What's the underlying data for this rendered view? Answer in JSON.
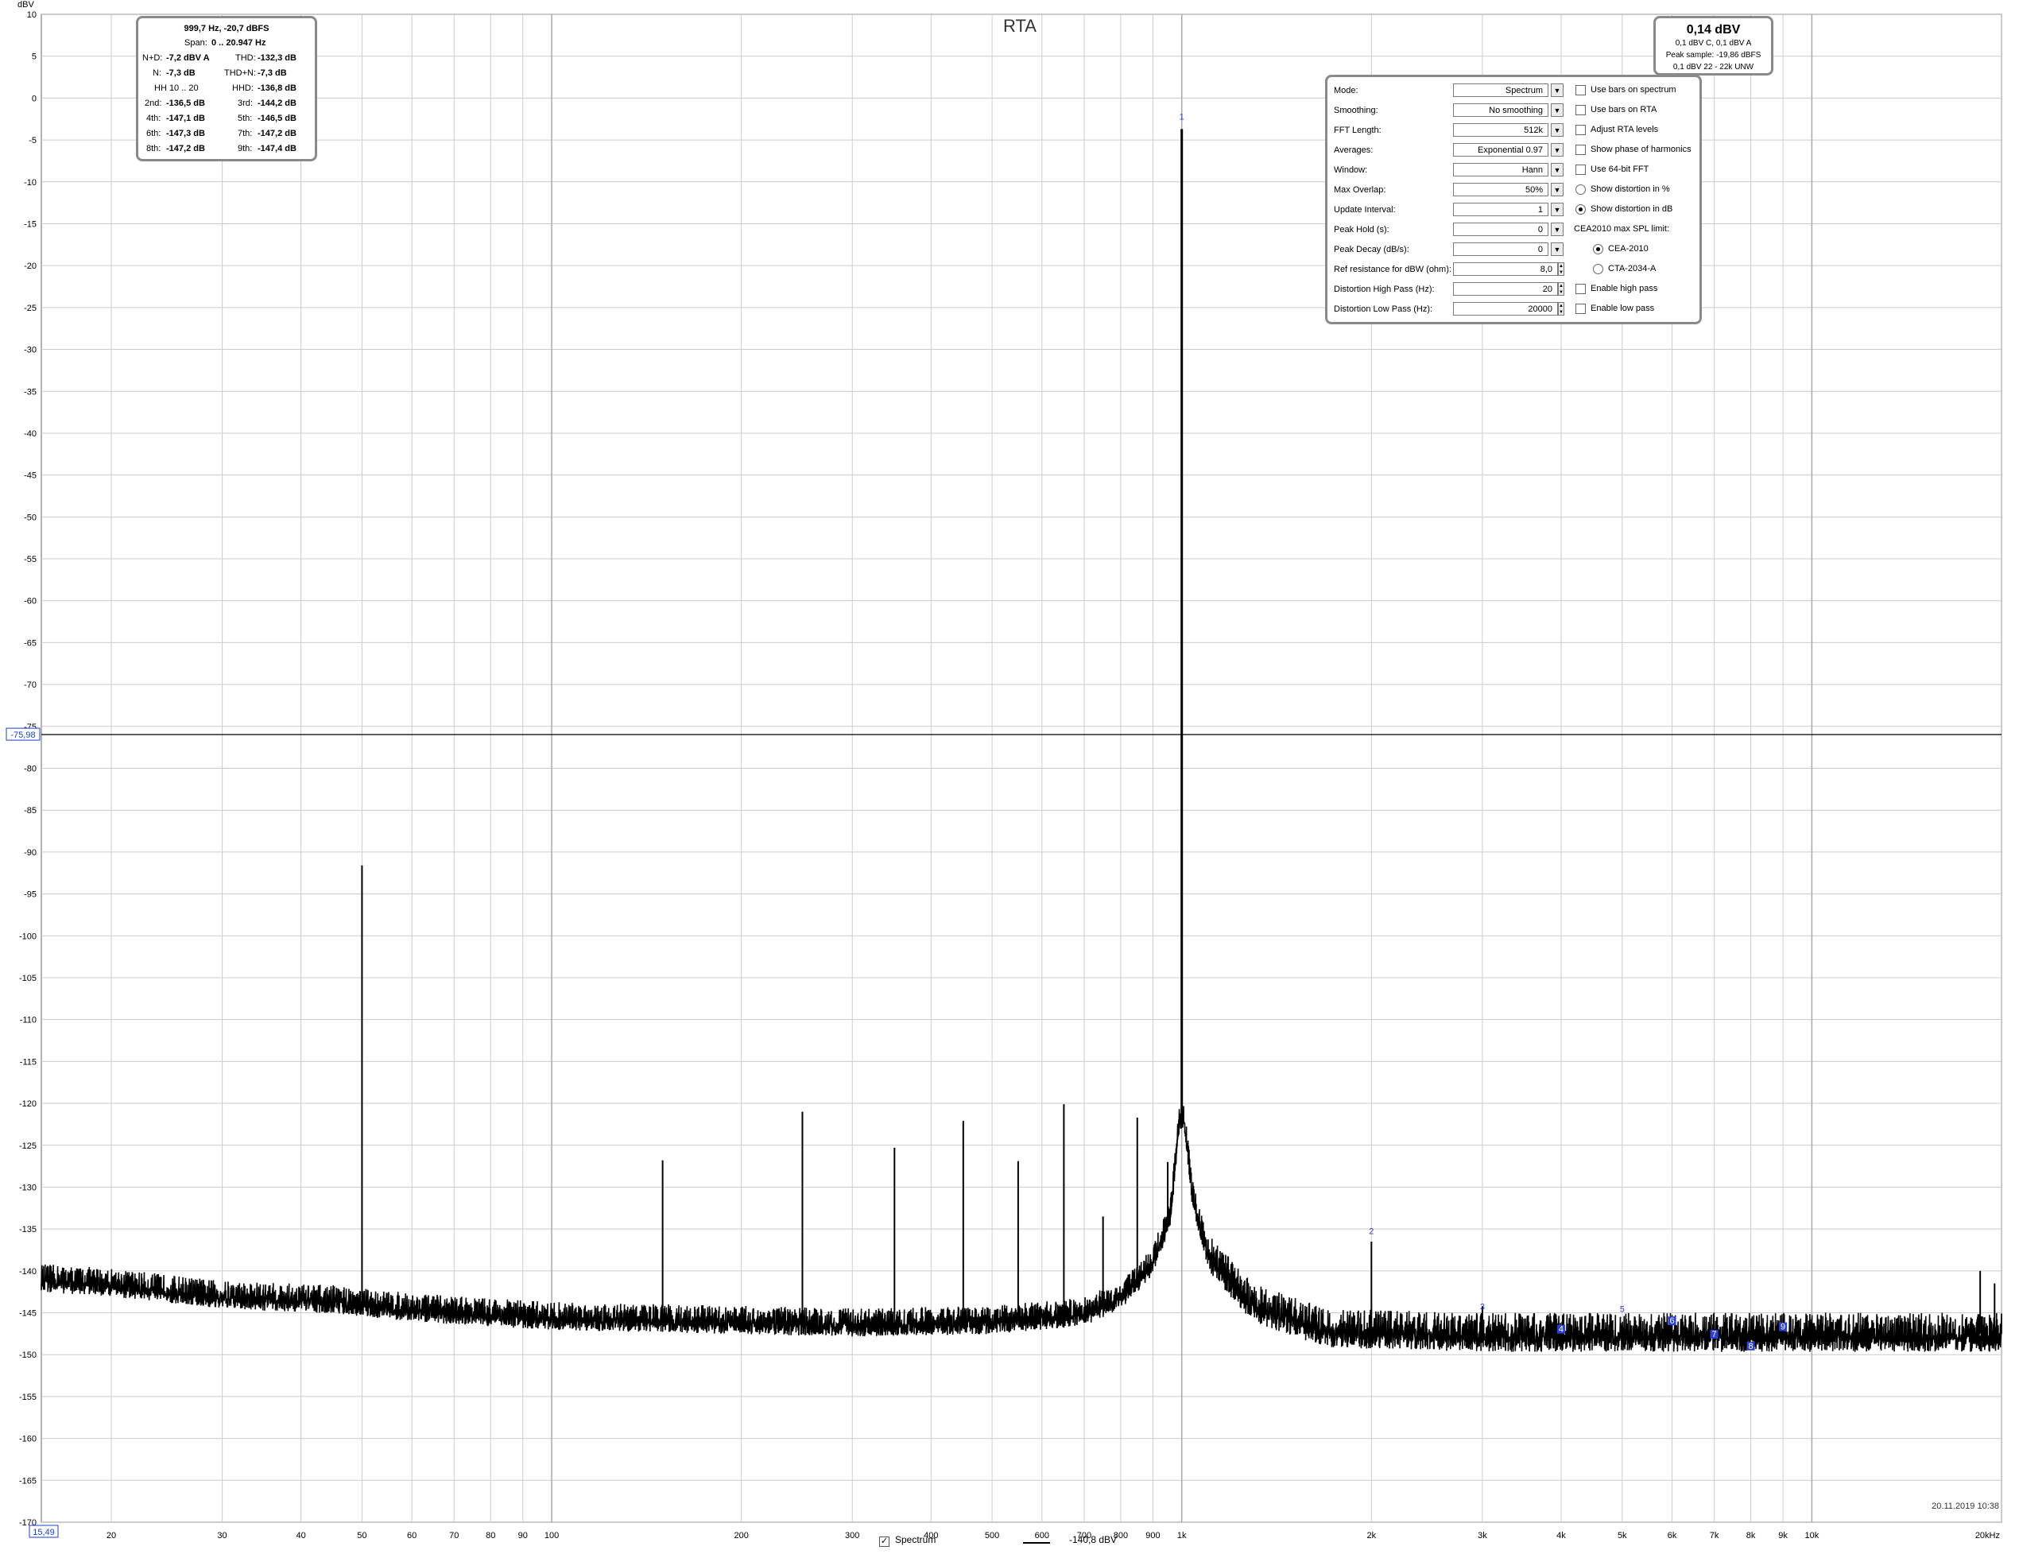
{
  "chart_data": {
    "type": "line",
    "title": "RTA",
    "ylabel": "dBV",
    "xunit": "kHz",
    "x_scale": "log",
    "xlim": [
      15.49,
      20000
    ],
    "ylim": [
      -170,
      10
    ],
    "y_ticks": [
      10,
      5,
      0,
      -5,
      -10,
      -15,
      -20,
      -25,
      -30,
      -35,
      -40,
      -45,
      -50,
      -55,
      -60,
      -65,
      -70,
      -75,
      -80,
      -85,
      -90,
      -95,
      -100,
      -105,
      -110,
      -115,
      -120,
      -125,
      -130,
      -135,
      -140,
      -145,
      -150,
      -155,
      -160,
      -165,
      -170
    ],
    "y_tick_labels": [
      "10",
      "5",
      "0",
      "-5",
      "-10",
      "-15",
      "-20",
      "-25",
      "-30",
      "-35",
      "-40",
      "-45",
      "-50",
      "-55",
      "-60",
      "-65",
      "-70",
      "-75",
      "-80",
      "-85",
      "-90",
      "-95",
      "-100",
      "-105",
      "-110",
      "-115",
      "-120",
      "-125",
      "-130",
      "-135",
      "-140",
      "-145",
      "-150",
      "-155",
      "-160",
      "-165",
      "-170"
    ],
    "x_ticks": [
      20,
      30,
      40,
      50,
      60,
      70,
      80,
      90,
      100,
      200,
      300,
      400,
      500,
      600,
      700,
      800,
      900,
      1000,
      2000,
      3000,
      4000,
      5000,
      6000,
      7000,
      8000,
      9000,
      10000,
      20000
    ],
    "x_tick_labels": [
      "20",
      "30",
      "40",
      "50",
      "60",
      "70",
      "80",
      "90",
      "100",
      "200",
      "300",
      "400",
      "500",
      "600",
      "700",
      "800",
      "900",
      "1k",
      "2k",
      "3k",
      "4k",
      "5k",
      "6k",
      "7k",
      "8k",
      "9k",
      "10k",
      "20kHz"
    ],
    "grid": true,
    "cursor": {
      "x": 15.49,
      "y": -75.98,
      "x_label": "15,49",
      "y_label": "-75,98"
    },
    "noise_floor": [
      {
        "x": 15.49,
        "y": -141
      },
      {
        "x": 20,
        "y": -141.5
      },
      {
        "x": 30,
        "y": -143
      },
      {
        "x": 45,
        "y": -143.5
      },
      {
        "x": 60,
        "y": -144.5
      },
      {
        "x": 100,
        "y": -145.5
      },
      {
        "x": 200,
        "y": -146
      },
      {
        "x": 300,
        "y": -146.3
      },
      {
        "x": 500,
        "y": -146
      },
      {
        "x": 700,
        "y": -145
      },
      {
        "x": 800,
        "y": -143
      },
      {
        "x": 900,
        "y": -139
      },
      {
        "x": 960,
        "y": -133
      },
      {
        "x": 990,
        "y": -122
      },
      {
        "x": 1010,
        "y": -122
      },
      {
        "x": 1040,
        "y": -131
      },
      {
        "x": 1100,
        "y": -138
      },
      {
        "x": 1300,
        "y": -144
      },
      {
        "x": 1700,
        "y": -147
      },
      {
        "x": 3000,
        "y": -147.5
      },
      {
        "x": 10000,
        "y": -147.5
      },
      {
        "x": 20000,
        "y": -147.5
      }
    ],
    "peaks": [
      {
        "x": 50,
        "y": -91.6
      },
      {
        "x": 150,
        "y": -126.8
      },
      {
        "x": 250,
        "y": -121
      },
      {
        "x": 350,
        "y": -125.3
      },
      {
        "x": 450,
        "y": -122.1
      },
      {
        "x": 550,
        "y": -126.9
      },
      {
        "x": 650,
        "y": -120.1
      },
      {
        "x": 750,
        "y": -133.5
      },
      {
        "x": 850,
        "y": -121.7
      },
      {
        "x": 950,
        "y": -127
      },
      {
        "x": 1000,
        "y": -3.7
      },
      {
        "x": 2000,
        "y": -136.5
      },
      {
        "x": 3000,
        "y": -144.2
      },
      {
        "x": 4000,
        "y": -147.1
      },
      {
        "x": 5000,
        "y": -146.5
      },
      {
        "x": 6000,
        "y": -147.3
      },
      {
        "x": 7000,
        "y": -147.2
      },
      {
        "x": 8000,
        "y": -147.2
      },
      {
        "x": 9000,
        "y": -147.4
      },
      {
        "x": 18500,
        "y": -140
      },
      {
        "x": 19500,
        "y": -141.5
      }
    ],
    "harmonic_markers": [
      {
        "n": "1",
        "x": 1000,
        "y": -2.5
      },
      {
        "n": "2",
        "x": 2000,
        "y": -135.5
      },
      {
        "n": "3",
        "x": 3000,
        "y": -144.5
      },
      {
        "n": "4",
        "x": 4000,
        "y": -147.2
      },
      {
        "n": "5",
        "x": 5000,
        "y": -144.8
      },
      {
        "n": "6",
        "x": 6000,
        "y": -146.2
      },
      {
        "n": "7",
        "x": 7000,
        "y": -147.8
      },
      {
        "n": "8",
        "x": 8000,
        "y": -149.2
      },
      {
        "n": "9",
        "x": 9000,
        "y": -146.9
      }
    ],
    "timestamp": "20.11.2019 10:38"
  },
  "info": {
    "line1": "999,7 Hz, -20,7 dBFS",
    "span_label": "Span:",
    "span_value": "0 .. 20.947 Hz",
    "nd_label": "N+D:",
    "nd_value": "-7,2 dBV A",
    "thd_label": "THD:",
    "thd_value": "-132,3 dB",
    "n_label": "N:",
    "n_value": "-7,3 dB",
    "thdn_label": "THD+N:",
    "thdn_value": "-7,3 dB",
    "hh_label": "HH 10 .. 20",
    "hhd_label": "HHD:",
    "hhd_value": "-136,8 dB",
    "h2_label": "2nd:",
    "h2_value": "-136,5 dB",
    "h3_label": "3rd:",
    "h3_value": "-144,2 dB",
    "h4_label": "4th:",
    "h4_value": "-147,1 dB",
    "h5_label": "5th:",
    "h5_value": "-146,5 dB",
    "h6_label": "6th:",
    "h6_value": "-147,3 dB",
    "h7_label": "7th:",
    "h7_value": "-147,2 dB",
    "h8_label": "8th:",
    "h8_value": "-147,2 dB",
    "h9_label": "9th:",
    "h9_value": "-147,4 dB"
  },
  "level": {
    "main": "0,14 dBV",
    "sub1": "0,1 dBV C, 0,1 dBV A",
    "sub2": "Peak sample: -19,86 dBFS",
    "sub3": "0,1 dBV 22 - 22k UNW"
  },
  "panel": {
    "mode_label": "Mode:",
    "mode_value": "Spectrum",
    "smoothing_label": "Smoothing:",
    "smoothing_value": "No  smoothing",
    "fft_label": "FFT Length:",
    "fft_value": "512k",
    "averages_label": "Averages:",
    "averages_value": "Exponential 0.97",
    "window_label": "Window:",
    "window_value": "Hann",
    "overlap_label": "Max Overlap:",
    "overlap_value": "50%",
    "update_label": "Update Interval:",
    "update_value": "1",
    "peakhold_label": "Peak Hold (s):",
    "peakhold_value": "0",
    "peakdecay_label": "Peak Decay (dB/s):",
    "peakdecay_value": "0",
    "refres_label": "Ref resistance for dBW (ohm):",
    "refres_value": "8,0",
    "disthp_label": "Distortion High Pass (Hz):",
    "disthp_value": "20",
    "distlp_label": "Distortion Low Pass (Hz):",
    "distlp_value": "20000",
    "cb_bars_spectrum": "Use bars on spectrum",
    "cb_bars_rta": "Use bars on RTA",
    "cb_adjust_rta": "Adjust RTA levels",
    "cb_phase": "Show phase of harmonics",
    "cb_64bit": "Use 64-bit FFT",
    "rb_dist_pct": "Show distortion in %",
    "rb_dist_db": "Show distortion in dB",
    "cea_label": "CEA2010 max SPL limit:",
    "rb_cea": "CEA-2010",
    "rb_cta": "CTA-2034-A",
    "cb_highpass": "Enable high pass",
    "cb_lowpass": "Enable low pass"
  },
  "legend": {
    "series_label": "Spectrum",
    "series_value": "-140,8 dBV",
    "check_glyph": "✓"
  }
}
